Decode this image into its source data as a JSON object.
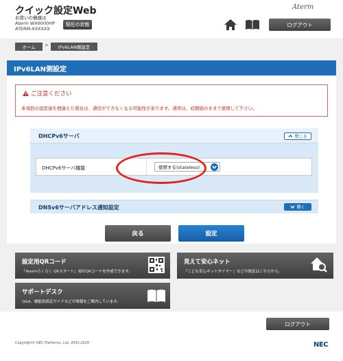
{
  "header": {
    "app_title": "クイック設定Web",
    "device_info_label": "お使いの機器は",
    "device_model": "Aterm WX6000HP",
    "device_ssid": "ATERM-XXXXXX",
    "status_button": "現在の状態",
    "brand_logo": "Aterm",
    "logout_label": "ログアウト"
  },
  "breadcrumb": {
    "home": "ホーム",
    "separator": ">",
    "current": "IPv6LAN側設定"
  },
  "page": {
    "title": "IPv6LAN側設定"
  },
  "caution": {
    "title": "ご注意ください",
    "text": "本項目の設定値を間違えた場合は、通信ができなくなる可能性があります。通常は、初期値のままで使用して下さい。"
  },
  "dhcp_section": {
    "title": "DHCPv6サーバ",
    "toggle_label": "閉じる",
    "row_label": "DHCPv6サーバ機能",
    "select_value": "使用する(stateless)"
  },
  "dns_section": {
    "title": "DNSv6サーバアドレス通知設定",
    "toggle_label": "開く"
  },
  "actions": {
    "back": "戻る",
    "set": "設定"
  },
  "tiles": {
    "qr": {
      "title": "設定用QRコード",
      "desc": "「Atermらくらく QRスタート」用のQRコードを作成できます。"
    },
    "mimamori": {
      "title": "見えて安心ネット",
      "desc": "「こども安心ネットタイマー」などの設定はこちらから。"
    },
    "support": {
      "title": "サポートデスク",
      "desc": "Q&A、機能別設定ガイドなどの情報をご案内しています。"
    }
  },
  "footer": {
    "logout_label": "ログアウト",
    "copyright": "Copyright© NEC Platforms, Ltd. 2001-2020",
    "nec_logo": "NEC"
  },
  "colors": {
    "primary_blue": "#1f6eb8",
    "caution_red": "#c23325",
    "highlight_ring": "#e4221b",
    "section_bg": "#d9e9f7"
  }
}
